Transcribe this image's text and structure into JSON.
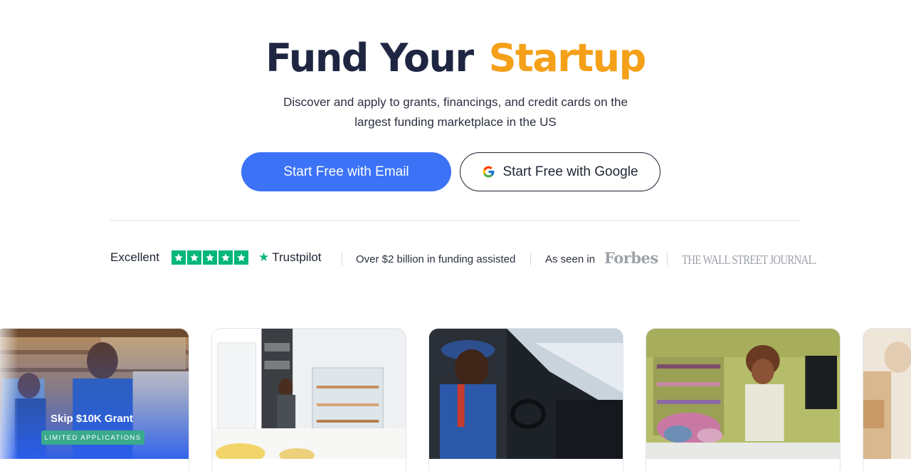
{
  "theme": {
    "primary": "#3b72f6",
    "accent": "#f5a019",
    "trustpilot_green": "#00b67a"
  },
  "hero": {
    "title_part1": "Fund Your",
    "title_part2": "Startup",
    "subtitle_line1": "Discover and apply to grants, financings, and credit cards on the",
    "subtitle_line2": "largest funding marketplace in the US"
  },
  "cta": {
    "email_label": "Start Free with Email",
    "google_label": "Start Free with Google",
    "google_icon": "google-g-icon"
  },
  "trust": {
    "rating_label": "Excellent",
    "star_count": 5,
    "trustpilot_label": "Trustpilot",
    "funding_text": "Over $2 billion in funding assisted",
    "seen_in_label": "As seen in",
    "press": [
      "Forbes",
      "THE WALL STREET JOURNAL."
    ]
  },
  "cards": [
    {
      "badge_title": "Skip $10K Grant",
      "badge_pill": "LIMITED APPLICATIONS"
    },
    {},
    {},
    {},
    {}
  ]
}
